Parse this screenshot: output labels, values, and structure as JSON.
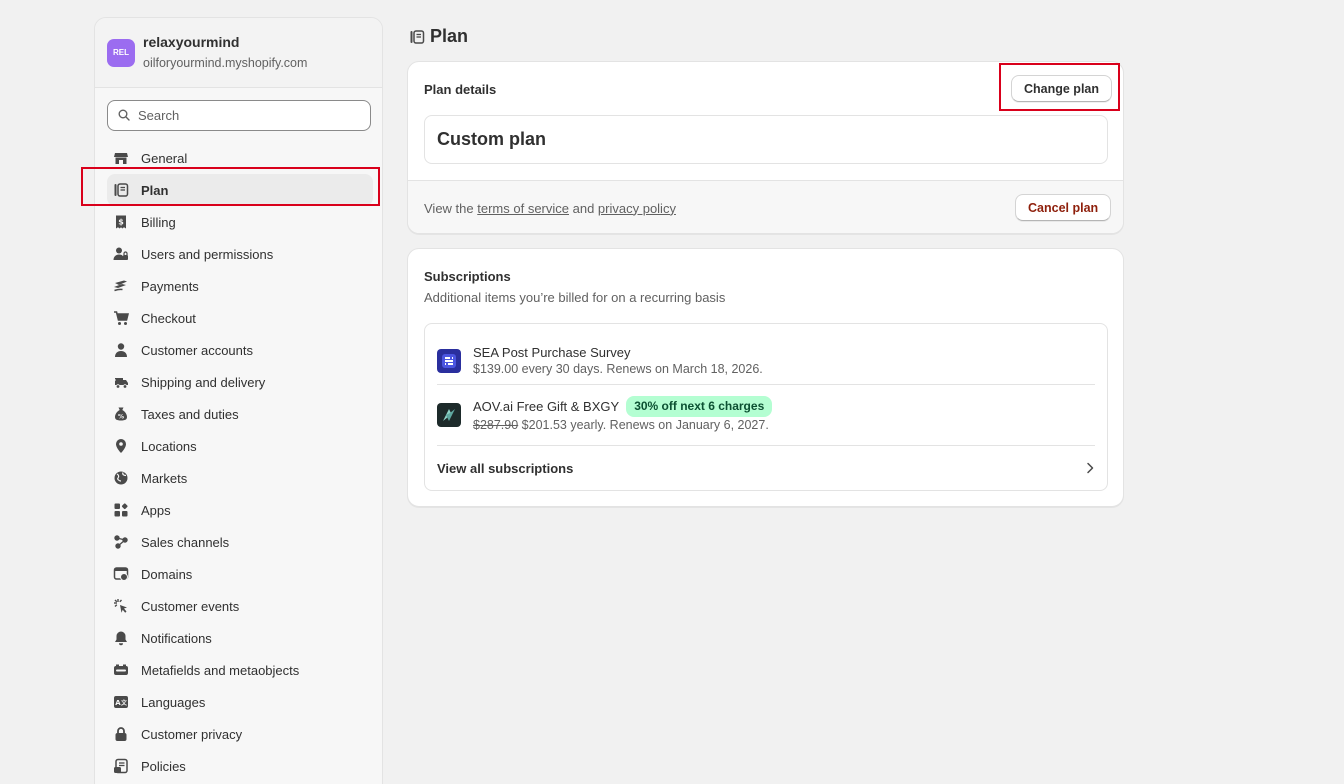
{
  "store": {
    "avatar_text": "REL",
    "name": "relaxyourmind",
    "domain": "oilforyourmind.myshopify.com",
    "avatar_color": "#9b6cf0"
  },
  "search": {
    "placeholder": "Search"
  },
  "nav": [
    {
      "label": "General",
      "icon": "store-icon"
    },
    {
      "label": "Plan",
      "icon": "plan-icon",
      "active": true
    },
    {
      "label": "Billing",
      "icon": "billing-icon"
    },
    {
      "label": "Users and permissions",
      "icon": "users-icon"
    },
    {
      "label": "Payments",
      "icon": "payments-icon"
    },
    {
      "label": "Checkout",
      "icon": "cart-icon"
    },
    {
      "label": "Customer accounts",
      "icon": "person-icon"
    },
    {
      "label": "Shipping and delivery",
      "icon": "truck-icon"
    },
    {
      "label": "Taxes and duties",
      "icon": "tax-icon"
    },
    {
      "label": "Locations",
      "icon": "location-icon"
    },
    {
      "label": "Markets",
      "icon": "globe-icon"
    },
    {
      "label": "Apps",
      "icon": "apps-icon"
    },
    {
      "label": "Sales channels",
      "icon": "channels-icon"
    },
    {
      "label": "Domains",
      "icon": "domain-icon"
    },
    {
      "label": "Customer events",
      "icon": "cursor-icon"
    },
    {
      "label": "Notifications",
      "icon": "bell-icon"
    },
    {
      "label": "Metafields and metaobjects",
      "icon": "metafields-icon"
    },
    {
      "label": "Languages",
      "icon": "language-icon"
    },
    {
      "label": "Customer privacy",
      "icon": "lock-icon"
    },
    {
      "label": "Policies",
      "icon": "policy-icon"
    }
  ],
  "page": {
    "title": "Plan"
  },
  "plan_card": {
    "heading": "Plan details",
    "change_button": "Change plan",
    "plan_name": "Custom plan",
    "footer_prefix": "View the ",
    "terms_link": "terms of service",
    "footer_and": " and ",
    "privacy_link": "privacy policy",
    "cancel_button": "Cancel plan"
  },
  "subscriptions": {
    "heading": "Subscriptions",
    "description": "Additional items you’re billed for on a recurring basis",
    "items": [
      {
        "name": "SEA Post Purchase Survey",
        "meta": "$139.00 every 30 days. Renews on March 18, 2026.",
        "icon": "sea-app-icon"
      },
      {
        "name": "AOV.ai Free Gift & BXGY",
        "badge": "30% off next 6 charges",
        "old_price": "$287.90",
        "meta": " $201.53 yearly. Renews on January 6, 2027.",
        "icon": "aov-app-icon"
      }
    ],
    "view_all": "View all subscriptions"
  },
  "colors": {
    "highlight": "#d9001b",
    "badge_bg": "#b4fed2",
    "cancel_text": "#8e1f0b"
  }
}
